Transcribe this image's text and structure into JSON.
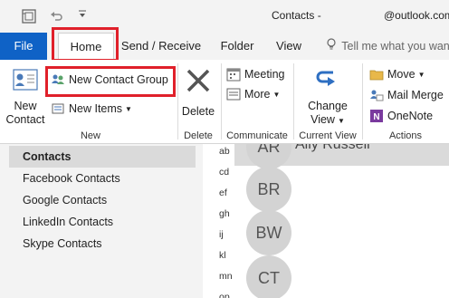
{
  "titlebar": {
    "title": "Contacts -",
    "account": "@outlook.com",
    "qa_more_glyph": "―"
  },
  "tabs": {
    "file": "File",
    "home": "Home",
    "send_receive": "Send / Receive",
    "folder": "Folder",
    "view": "View",
    "tell_me": "Tell me what you want"
  },
  "ribbon": {
    "new_contact": "New Contact",
    "new_contact_line1": "New",
    "new_contact_line2": "Contact",
    "new_contact_group": "New Contact Group",
    "new_items": "New Items",
    "new_group_label": "New",
    "delete": "Delete",
    "delete_group_label": "Delete",
    "meeting": "Meeting",
    "more": "More",
    "communicate_label": "Communicate",
    "change_view_line1": "Change",
    "change_view_line2": "View",
    "current_view_label": "Current View",
    "move": "Move",
    "mail_merge": "Mail Merge",
    "onenote": "OneNote",
    "actions_label": "Actions"
  },
  "nav": {
    "items": [
      "Contacts",
      "Facebook Contacts",
      "Google Contacts",
      "LinkedIn Contacts",
      "Skype Contacts"
    ]
  },
  "contacts": {
    "alphabet": [
      "ab",
      "cd",
      "ef",
      "gh",
      "ij",
      "kl",
      "mn",
      "op"
    ],
    "partial_name": "Ally Russell",
    "avatars": [
      "AR",
      "BR",
      "BW",
      "CT"
    ]
  },
  "colors": {
    "file_tab": "#0f62c6",
    "highlight": "#e0202a",
    "avatar": "#d3d3d3"
  }
}
